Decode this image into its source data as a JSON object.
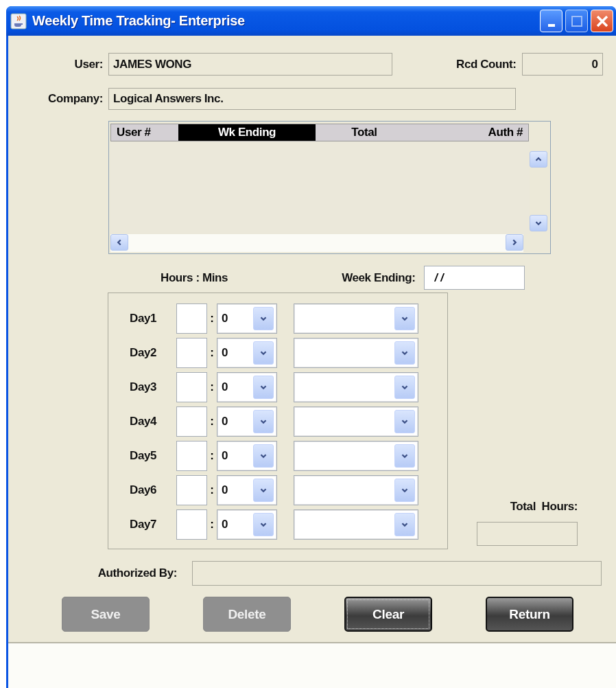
{
  "window": {
    "title": "Weekly Time Tracking- Enterprise"
  },
  "user": {
    "label": "User:",
    "value": "JAMES WONG"
  },
  "record_count": {
    "label": "Rcd Count:",
    "value": "0"
  },
  "company": {
    "label": "Company:",
    "value": "Logical Answers Inc."
  },
  "table": {
    "columns": [
      {
        "label": "User #",
        "selected": false
      },
      {
        "label": "Wk Ending",
        "selected": true
      },
      {
        "label": "Total",
        "selected": false
      },
      {
        "label": "Auth #",
        "selected": false
      }
    ]
  },
  "hours_mins_label": "Hours : Mins",
  "week_ending": {
    "label": "Week Ending:",
    "value": "/ /"
  },
  "days": [
    {
      "label": "Day1",
      "separator": ":",
      "minutes": "0"
    },
    {
      "label": "Day2",
      "separator": ":",
      "minutes": "0"
    },
    {
      "label": "Day3",
      "separator": ":",
      "minutes": "0"
    },
    {
      "label": "Day4",
      "separator": ":",
      "minutes": "0"
    },
    {
      "label": "Day5",
      "separator": ":",
      "minutes": "0"
    },
    {
      "label": "Day6",
      "separator": ":",
      "minutes": "0"
    },
    {
      "label": "Day7",
      "separator": ":",
      "minutes": "0"
    }
  ],
  "total_hours": {
    "label": "Total  Hours:"
  },
  "authorized_by": {
    "label": "Authorized By:"
  },
  "buttons": [
    {
      "label": "Save",
      "disabled": true
    },
    {
      "label": "Delete",
      "disabled": true
    },
    {
      "label": "Clear",
      "disabled": false
    },
    {
      "label": "Return",
      "disabled": false
    }
  ]
}
